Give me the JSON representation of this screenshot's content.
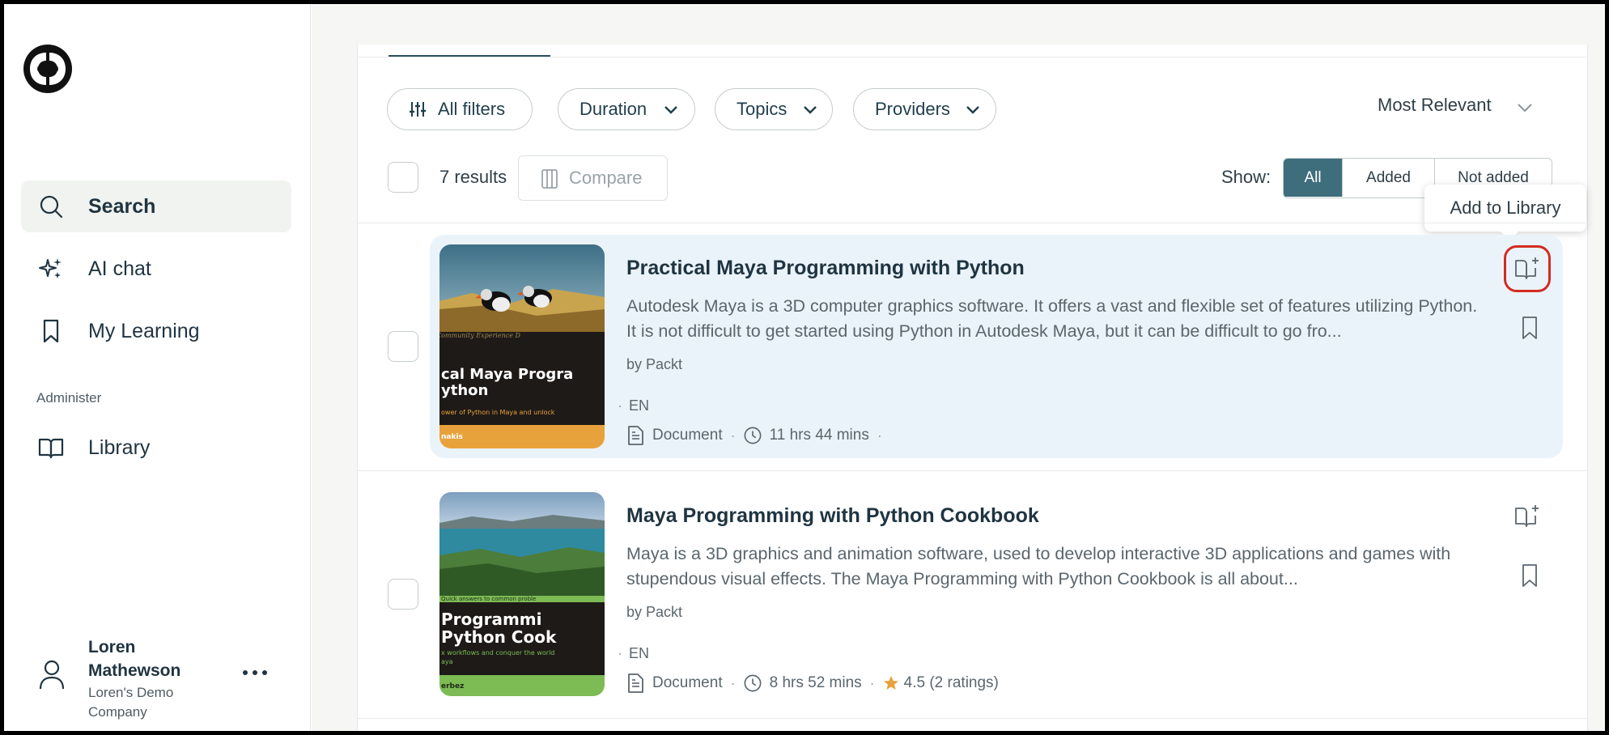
{
  "sidebar": {
    "nav": [
      {
        "label": "Search",
        "icon": "search-icon",
        "active": true
      },
      {
        "label": "AI chat",
        "icon": "sparkle-icon"
      },
      {
        "label": "My Learning",
        "icon": "bookmark-icon"
      }
    ],
    "section_label": "Administer",
    "admin_nav": [
      {
        "label": "Library",
        "icon": "book-open-icon"
      }
    ],
    "user": {
      "name": "Loren Mathewson",
      "company": "Loren's Demo Company"
    }
  },
  "filters": {
    "all_filters_label": "All filters",
    "duration_label": "Duration",
    "topics_label": "Topics",
    "providers_label": "Providers"
  },
  "sort": {
    "label": "Most Relevant"
  },
  "results": {
    "count_label": "7 results",
    "compare_label": "Compare",
    "show_label": "Show:",
    "show_options": [
      "All",
      "Added",
      "Not added"
    ],
    "show_selected": "All"
  },
  "tooltip": {
    "text": "Add to Library"
  },
  "cards": [
    {
      "title": "Practical Maya Programming with Python",
      "description": "Autodesk Maya is a 3D computer graphics software. It offers a vast and flexible set of features utilizing Python. It is not difficult to get started using Python in Autodesk Maya, but it can be difficult to go fro...",
      "provider": "by Packt",
      "language": "EN",
      "type": "Document",
      "duration": "11 hrs 44 mins",
      "thumb": {
        "line1": "cal Maya Progra",
        "line2": "ython",
        "tagline": "ower of Python in Maya and unlock",
        "author": "nakis",
        "band_color": "#e8a23b"
      }
    },
    {
      "title": "Maya Programming with Python Cookbook",
      "description": "Maya is a 3D graphics and animation software, used to develop interactive 3D applications and games with stupendous visual effects. The Maya Programming with Python Cookbook is all about...",
      "provider": "by Packt",
      "language": "EN",
      "type": "Document",
      "duration": "8 hrs 52 mins",
      "rating": "4.5 (2 ratings)",
      "thumb": {
        "subtitle": "Quick answers to common proble",
        "line1": "Programmi",
        "line2": "Python Cook",
        "tagline": "x workflows and conquer the world",
        "tagline2": "aya",
        "author": "erbez",
        "band_color": "#7dbb55"
      }
    }
  ],
  "colors": {
    "accent": "#3e6e7b",
    "highlight": "#ebf3fa",
    "focus_ring": "#d32b22",
    "star": "#e8a23b"
  }
}
